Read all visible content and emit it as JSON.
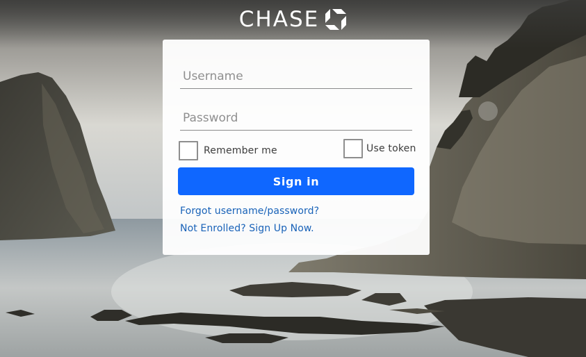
{
  "brand": {
    "name": "CHASE"
  },
  "login": {
    "username_placeholder": "Username",
    "password_placeholder": "Password",
    "remember_label": "Remember me",
    "token_label": "Use token",
    "signin_label": "Sign in",
    "forgot_link": "Forgot username/password?",
    "enroll_link": "Not Enrolled? Sign Up Now."
  },
  "colors": {
    "primary_button": "#0f67ff",
    "link": "#1862b8",
    "card_background": "#ffffff"
  },
  "icons": {
    "logo": "chase-octagon-logo-icon"
  }
}
